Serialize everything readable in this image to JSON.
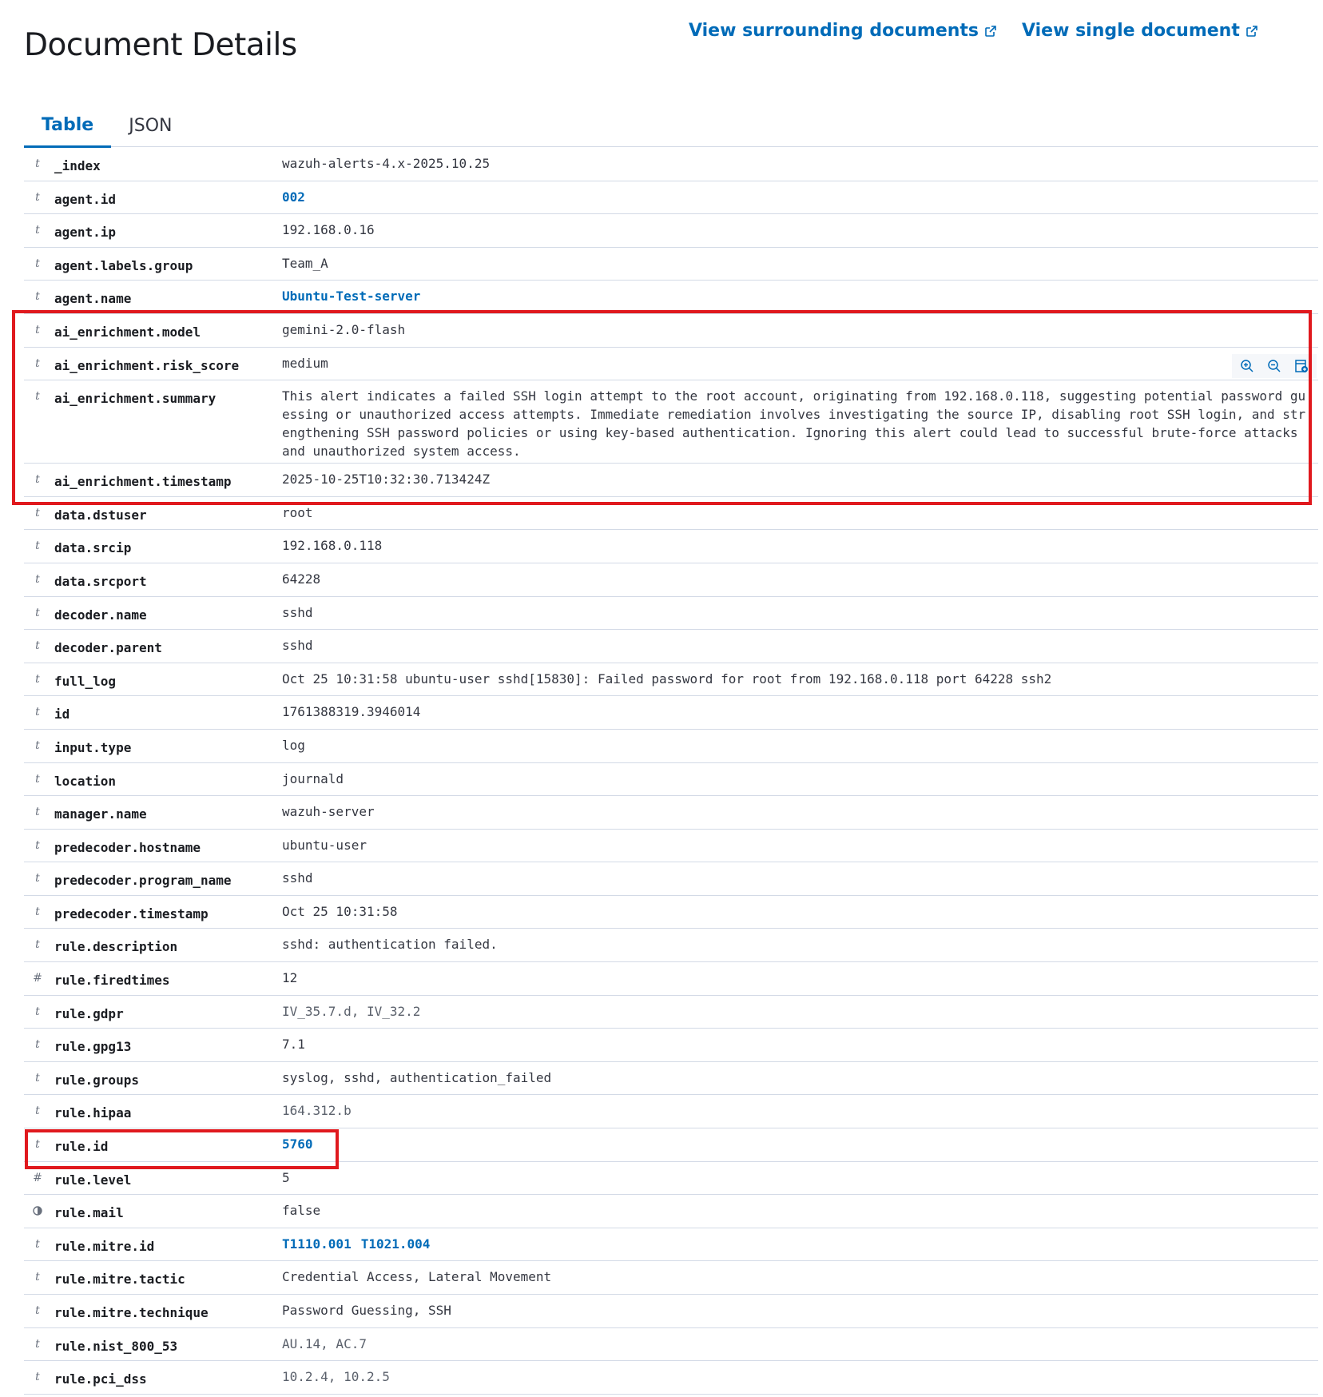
{
  "page": {
    "title": "Document Details",
    "links": {
      "surrounding": "View surrounding documents",
      "single": "View single document"
    },
    "tabs": [
      {
        "label": "Table",
        "active": true
      },
      {
        "label": "JSON",
        "active": false
      }
    ]
  },
  "colors": {
    "link": "#006bb8",
    "highlight": "#e0191e",
    "border": "#d3dae6"
  },
  "row_action_icons": [
    "zoom-in-icon",
    "zoom-out-icon",
    "toggle-column-icon"
  ],
  "fields": [
    {
      "type": "t",
      "name": "_index",
      "value": "wazuh-alerts-4.x-2025.10.25"
    },
    {
      "type": "t",
      "name": "agent.id",
      "value": "002",
      "link": true
    },
    {
      "type": "t",
      "name": "agent.ip",
      "value": "192.168.0.16"
    },
    {
      "type": "t",
      "name": "agent.labels.group",
      "value": "Team_A"
    },
    {
      "type": "t",
      "name": "agent.name",
      "value": "Ubuntu-Test-server",
      "link": true
    },
    {
      "type": "t",
      "name": "ai_enrichment.model",
      "value": "gemini-2.0-flash"
    },
    {
      "type": "t",
      "name": "ai_enrichment.risk_score",
      "value": "medium"
    },
    {
      "type": "t",
      "name": "ai_enrichment.summary",
      "value": "This alert indicates a failed SSH login attempt to the root account, originating from 192.168.0.118, suggesting potential password guessing or unauthorized access attempts. Immediate remediation involves investigating the source IP, disabling root SSH login, and strengthening SSH password policies or using key-based authentication. Ignoring this alert could lead to successful brute-force attacks and unauthorized system access."
    },
    {
      "type": "t",
      "name": "ai_enrichment.timestamp",
      "value": "2025-10-25T10:32:30.713424Z"
    },
    {
      "type": "t",
      "name": "data.dstuser",
      "value": "root"
    },
    {
      "type": "t",
      "name": "data.srcip",
      "value": "192.168.0.118"
    },
    {
      "type": "t",
      "name": "data.srcport",
      "value": "64228"
    },
    {
      "type": "t",
      "name": "decoder.name",
      "value": "sshd"
    },
    {
      "type": "t",
      "name": "decoder.parent",
      "value": "sshd"
    },
    {
      "type": "t",
      "name": "full_log",
      "value": "Oct 25 10:31:58 ubuntu-user sshd[15830]: Failed password for root from 192.168.0.118 port 64228 ssh2"
    },
    {
      "type": "t",
      "name": "id",
      "value": "1761388319.3946014"
    },
    {
      "type": "t",
      "name": "input.type",
      "value": "log"
    },
    {
      "type": "t",
      "name": "location",
      "value": "journald"
    },
    {
      "type": "t",
      "name": "manager.name",
      "value": "wazuh-server"
    },
    {
      "type": "t",
      "name": "predecoder.hostname",
      "value": "ubuntu-user"
    },
    {
      "type": "t",
      "name": "predecoder.program_name",
      "value": "sshd"
    },
    {
      "type": "t",
      "name": "predecoder.timestamp",
      "value": "Oct 25 10:31:58"
    },
    {
      "type": "t",
      "name": "rule.description",
      "value": "sshd: authentication failed."
    },
    {
      "type": "#",
      "name": "rule.firedtimes",
      "value": "12"
    },
    {
      "type": "t",
      "name": "rule.gdpr",
      "value": "IV_35.7.d, IV_32.2",
      "light": true
    },
    {
      "type": "t",
      "name": "rule.gpg13",
      "value": "7.1"
    },
    {
      "type": "t",
      "name": "rule.groups",
      "value": "syslog, sshd, authentication_failed"
    },
    {
      "type": "t",
      "name": "rule.hipaa",
      "value": "164.312.b",
      "light": true
    },
    {
      "type": "t",
      "name": "rule.id",
      "value": "5760",
      "link": true
    },
    {
      "type": "#",
      "name": "rule.level",
      "value": "5"
    },
    {
      "type": "b",
      "name": "rule.mail",
      "value": "false"
    },
    {
      "type": "t",
      "name": "rule.mitre.id",
      "value": [
        "T1110.001",
        "T1021.004"
      ],
      "link": true
    },
    {
      "type": "t",
      "name": "rule.mitre.tactic",
      "value": "Credential Access, Lateral Movement"
    },
    {
      "type": "t",
      "name": "rule.mitre.technique",
      "value": "Password Guessing, SSH"
    },
    {
      "type": "t",
      "name": "rule.nist_800_53",
      "value": "AU.14, AC.7",
      "light": true
    },
    {
      "type": "t",
      "name": "rule.pci_dss",
      "value": "10.2.4, 10.2.5",
      "light": true
    }
  ]
}
